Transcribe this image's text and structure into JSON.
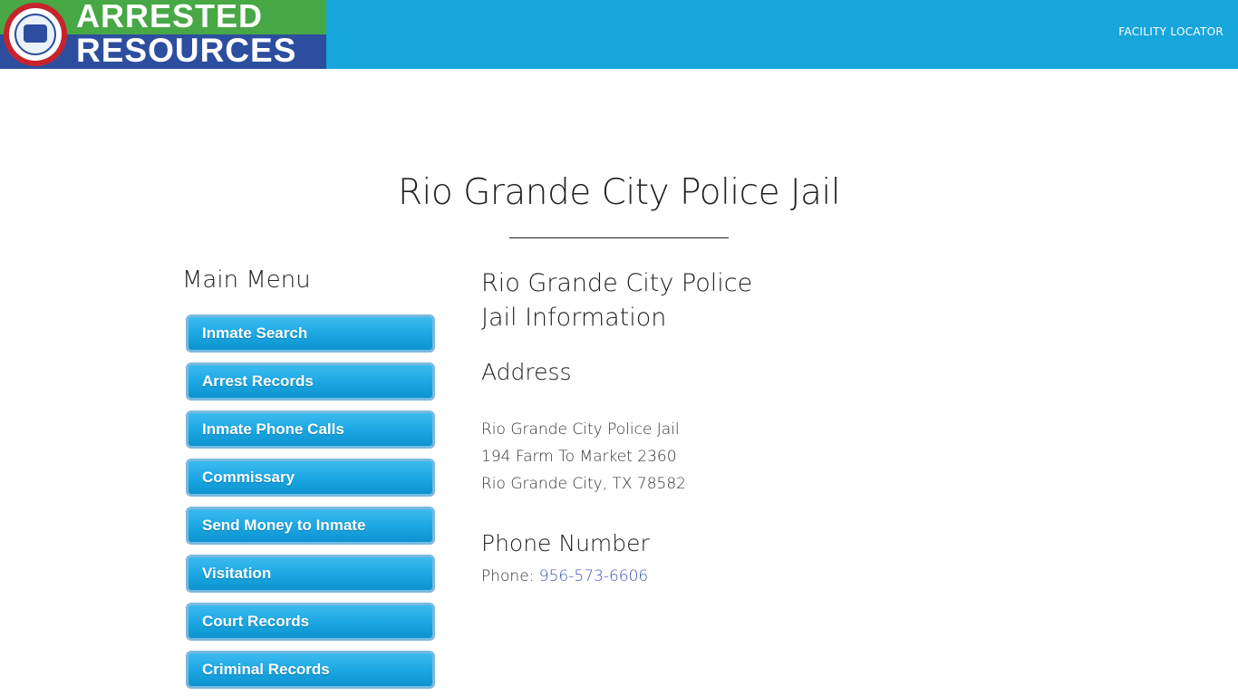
{
  "header": {
    "logo_line1": "ARRESTED",
    "logo_line2": "RESOURCES",
    "nav_link": "FACILITY LOCATOR",
    "bg_color": "#17a6dc"
  },
  "page": {
    "title": "Rio Grande City Police Jail"
  },
  "sidebar": {
    "heading": "Main Menu",
    "items": [
      {
        "label": "Inmate Search"
      },
      {
        "label": "Arrest Records"
      },
      {
        "label": "Inmate Phone Calls"
      },
      {
        "label": "Commissary"
      },
      {
        "label": "Send Money to Inmate"
      },
      {
        "label": "Visitation"
      },
      {
        "label": "Court Records"
      },
      {
        "label": "Criminal Records"
      }
    ]
  },
  "main": {
    "info_heading": "Rio Grande City Police Jail Information",
    "address_heading": "Address",
    "address": {
      "line1": "Rio Grande City Police Jail",
      "line2": "194 Farm To Market 2360",
      "line3": "Rio Grande City, TX 78582"
    },
    "phone_heading": "Phone Number",
    "phone_label": "Phone: ",
    "phone_number": "956-573-6606",
    "link_color": "#3b57c4"
  }
}
